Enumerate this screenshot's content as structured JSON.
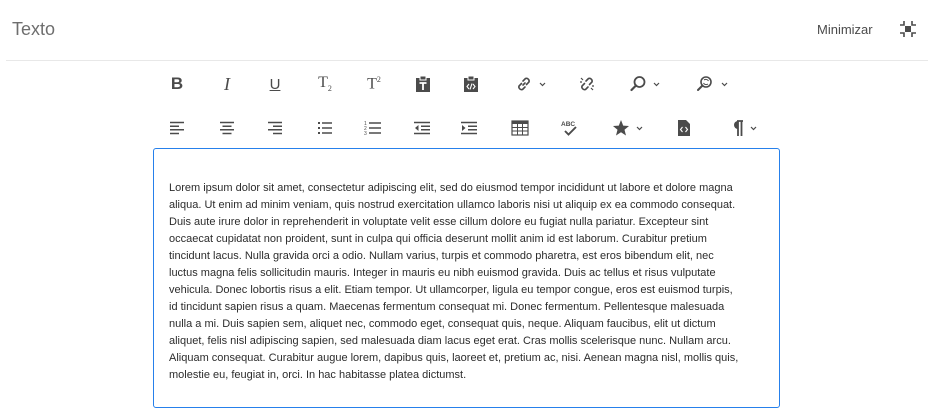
{
  "header": {
    "title": "Texto",
    "minimize_label": "Minimizar"
  },
  "toolbar": {
    "row1": [
      {
        "name": "bold",
        "icon": "bold-icon",
        "label": "B"
      },
      {
        "name": "italic",
        "icon": "italic-icon",
        "label": "I"
      },
      {
        "name": "underline",
        "icon": "underline-icon",
        "label": "U"
      },
      {
        "name": "subscript",
        "icon": "subscript-icon",
        "label": "T"
      },
      {
        "name": "superscript",
        "icon": "superscript-icon",
        "label": "T"
      },
      {
        "name": "paste-text",
        "icon": "paste-text-icon"
      },
      {
        "name": "paste-html",
        "icon": "paste-html-icon"
      },
      {
        "name": "link",
        "icon": "link-icon",
        "dropdown": true
      },
      {
        "name": "unlink",
        "icon": "unlink-icon"
      },
      {
        "name": "find",
        "icon": "search-icon",
        "dropdown": true
      },
      {
        "name": "find-replace",
        "icon": "find-replace-icon",
        "dropdown": true
      }
    ],
    "row2": [
      {
        "name": "align-left",
        "icon": "align-left-icon"
      },
      {
        "name": "align-center",
        "icon": "align-center-icon"
      },
      {
        "name": "align-right",
        "icon": "align-right-icon"
      },
      {
        "name": "bullet-list",
        "icon": "bullet-list-icon"
      },
      {
        "name": "numbered-list",
        "icon": "numbered-list-icon"
      },
      {
        "name": "outdent",
        "icon": "outdent-icon"
      },
      {
        "name": "indent",
        "icon": "indent-icon"
      },
      {
        "name": "table",
        "icon": "table-icon"
      },
      {
        "name": "spellcheck",
        "icon": "spellcheck-icon",
        "label": "ABC"
      },
      {
        "name": "special-chars",
        "icon": "star-icon",
        "dropdown": true
      },
      {
        "name": "source-edit",
        "icon": "source-edit-icon"
      },
      {
        "name": "paragraph",
        "icon": "pilcrow-icon",
        "dropdown": true
      }
    ]
  },
  "editor": {
    "content": "Lorem ipsum dolor sit amet, consectetur adipiscing elit, sed do eiusmod tempor incididunt ut labore et dolore magna aliqua. Ut enim ad minim veniam, quis nostrud exercitation ullamco laboris nisi ut aliquip ex ea commodo consequat. Duis aute irure dolor in reprehenderit in voluptate velit esse cillum dolore eu fugiat nulla pariatur. Excepteur sint occaecat cupidatat non proident, sunt in culpa qui officia deserunt mollit anim id est laborum. Curabitur pretium tincidunt lacus. Nulla gravida orci a odio. Nullam varius, turpis et commodo pharetra, est eros bibendum elit, nec luctus magna felis sollicitudin mauris. Integer in mauris eu nibh euismod gravida. Duis ac tellus et risus vulputate vehicula. Donec lobortis risus a elit. Etiam tempor. Ut ullamcorper, ligula eu tempor congue, eros est euismod turpis, id tincidunt sapien risus a quam. Maecenas fermentum consequat mi. Donec fermentum. Pellentesque malesuada nulla a mi. Duis sapien sem, aliquet nec, commodo eget, consequat quis, neque. Aliquam faucibus, elit ut dictum aliquet, felis nisl adipiscing sapien, sed malesuada diam lacus eget erat. Cras mollis scelerisque nunc. Nullam arcu. Aliquam consequat. Curabitur augue lorem, dapibus quis, laoreet et, pretium ac, nisi. Aenean magna nisl, mollis quis, molestie eu, feugiat in, orci. In hac habitasse platea dictumst."
  },
  "colors": {
    "icon": "#4b4b4b",
    "focus_border": "#2680eb",
    "divider": "#e8e8e8"
  }
}
